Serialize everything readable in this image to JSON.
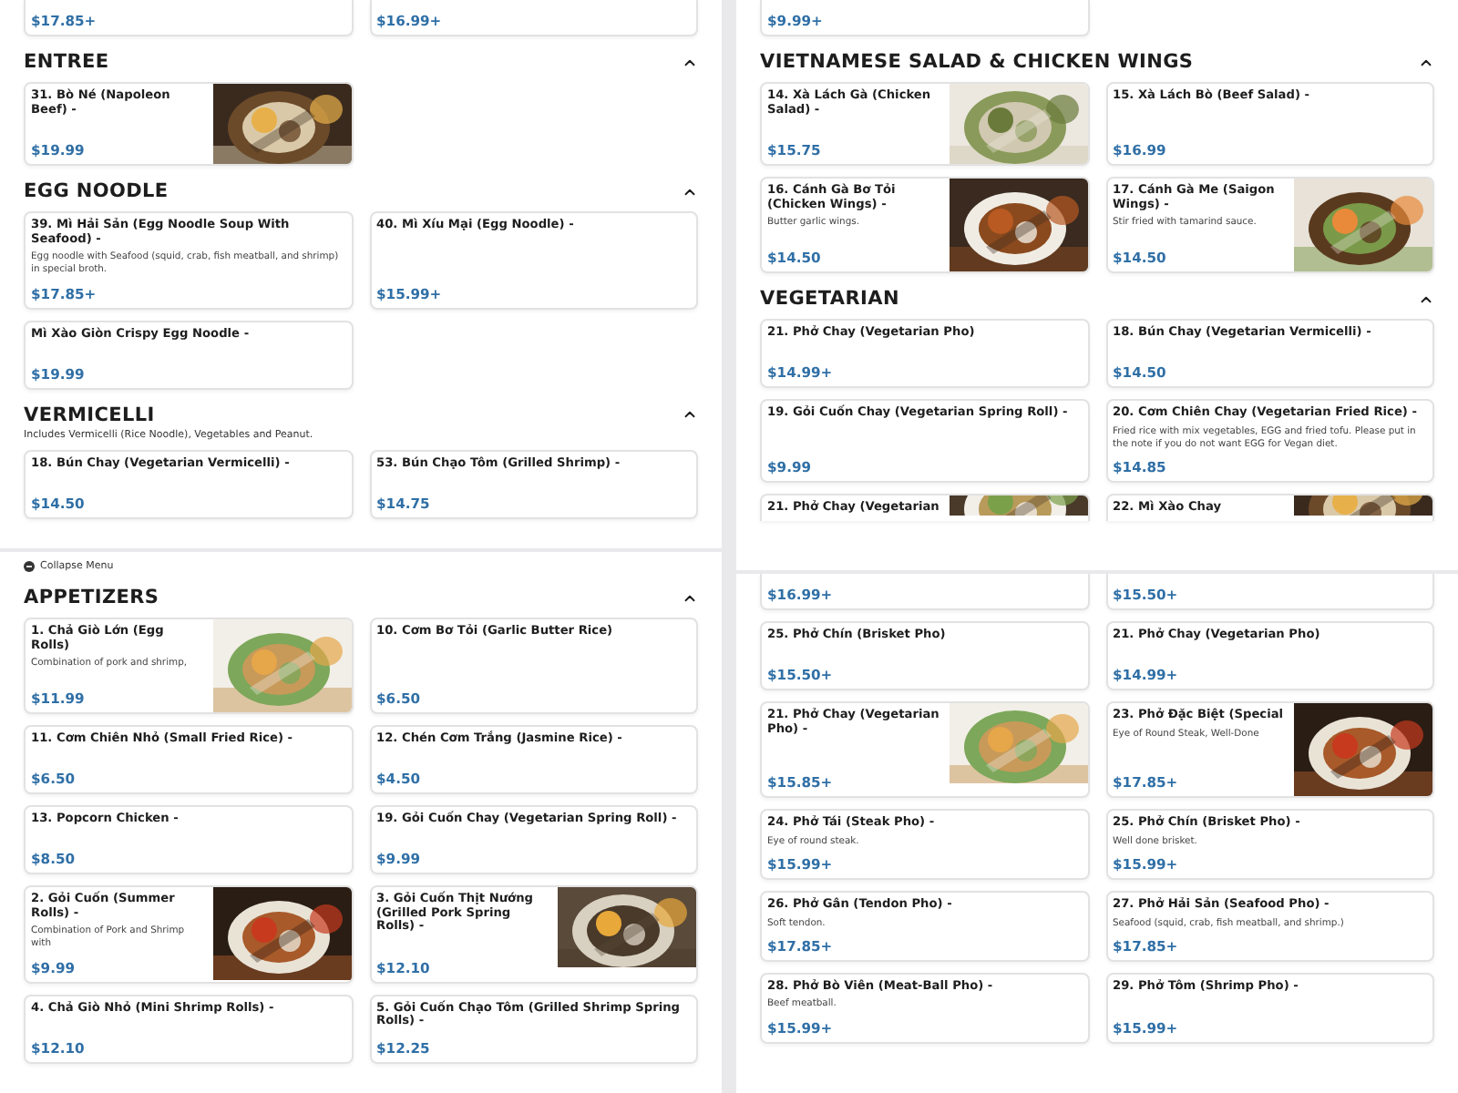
{
  "panes": [
    {
      "panels": [
        {
          "lead": [
            {
              "kind": "bottom",
              "price": "$17.85+"
            },
            {
              "kind": "bottom",
              "price": "$16.99+"
            }
          ],
          "sections": [
            {
              "title": "ENTREE",
              "expanded": true,
              "cards": [
                {
                  "kind": "full",
                  "title": "31. Bò Né (Napoleon Beef) -",
                  "price": "$19.99"
                }
              ]
            },
            {
              "title": "EGG NOODLE",
              "expanded": true,
              "cards": [
                {
                  "kind": "full",
                  "title": "39. Mì Hải Sản (Egg Noodle Soup With Seafood) -",
                  "description": "Egg noodle with Seafood (squid, crab, fish meatball, and shrimp) in special broth.",
                  "price": "$17.85+"
                },
                {
                  "kind": "full",
                  "title": "40. Mì Xíu Mại (Egg Noodle) -",
                  "price": "$15.99+"
                },
                {
                  "kind": "full",
                  "title": "Mì Xào Giòn Crispy Egg Noodle -",
                  "price": "$19.99"
                }
              ]
            },
            {
              "title": "VERMICELLI",
              "subtitle": "Includes Vermicelli (Rice Noodle), Vegetables and Peanut.",
              "expanded": true,
              "cards": [
                {
                  "kind": "full",
                  "title": "18. Bún Chay (Vegetarian Vermicelli) -",
                  "price": "$14.50"
                },
                {
                  "kind": "full",
                  "title": "53. Bún Chạo Tôm (Grilled Shrimp) -",
                  "price": "$14.75"
                }
              ]
            }
          ]
        },
        {
          "collapse": "Collapse Menu",
          "sections": [
            {
              "title": "APPETIZERS",
              "expanded": true,
              "cards": [
                {
                  "kind": "full",
                  "title": "1. Chả Giò Lớn (Egg Rolls)",
                  "description": "Combination of pork and shrimp,",
                  "price": "$11.99"
                },
                {
                  "kind": "full",
                  "title": "10. Cơm Bơ Tỏi (Garlic Butter Rice)",
                  "price": "$6.50"
                },
                {
                  "kind": "full",
                  "title": "11. Cơm Chiên Nhỏ (Small Fried Rice) -",
                  "price": "$6.50"
                },
                {
                  "kind": "full",
                  "title": "12. Chén Cơm Trắng (Jasmine Rice) -",
                  "price": "$4.50"
                },
                {
                  "kind": "full",
                  "title": "13. Popcorn Chicken -",
                  "price": "$8.50"
                },
                {
                  "kind": "full",
                  "title": "19. Gỏi Cuốn Chay (Vegetarian Spring Roll) -",
                  "price": "$9.99"
                },
                {
                  "kind": "full",
                  "title": "2. Gỏi Cuốn (Summer Rolls) -",
                  "description": "Combination of Pork and Shrimp with",
                  "price": "$9.99"
                },
                {
                  "kind": "full",
                  "title": "3. Gỏi Cuốn Thịt Nướng (Grilled Pork Spring Rolls) -",
                  "price": "$12.10"
                },
                {
                  "kind": "full",
                  "title": "4. Chả Giò Nhỏ (Mini Shrimp Rolls) -",
                  "price": "$12.10"
                },
                {
                  "kind": "full",
                  "title": "5. Gỏi Cuốn Chạo Tôm (Grilled Shrimp Spring Rolls) -",
                  "price": "$12.25"
                }
              ]
            }
          ]
        }
      ]
    },
    {
      "panels": [
        {
          "lead": [
            {
              "kind": "bottom",
              "price": "$9.99+"
            }
          ],
          "sections": [
            {
              "title": "VIETNAMESE SALAD & CHICKEN WINGS",
              "expanded": true,
              "cards": [
                {
                  "kind": "full",
                  "title": "14. Xà Lách Gà (Chicken Salad) -",
                  "price": "$15.75"
                },
                {
                  "kind": "full",
                  "title": "15. Xà Lách Bò (Beef Salad) -",
                  "price": "$16.99"
                },
                {
                  "kind": "full",
                  "title": "16. Cánh Gà Bơ Tỏi (Chicken Wings) -",
                  "description": "Butter garlic wings.",
                  "price": "$14.50"
                },
                {
                  "kind": "full",
                  "title": "17. Cánh Gà Me (Saigon Wings) -",
                  "description": "Stir fried with tamarind sauce.",
                  "price": "$14.50"
                }
              ]
            },
            {
              "title": "VEGETARIAN",
              "expanded": true,
              "cards": [
                {
                  "kind": "full",
                  "title": "21. Phở Chay (Vegetarian Pho)",
                  "price": "$14.99+"
                },
                {
                  "kind": "full",
                  "title": "18. Bún Chay (Vegetarian Vermicelli) -",
                  "price": "$14.50"
                },
                {
                  "kind": "full",
                  "title": "19. Gỏi Cuốn Chay (Vegetarian Spring Roll) -",
                  "price": "$9.99"
                },
                {
                  "kind": "full",
                  "title": "20. Cơm Chiên Chay (Vegetarian Fried Rice) -",
                  "description": "Fried rice with mix vegetables, EGG and fried tofu. Please put in the note if you do not want EGG for Vegan diet.",
                  "price": "$14.85"
                },
                {
                  "kind": "top",
                  "title": "21. Phở Chay (Vegetarian"
                },
                {
                  "kind": "top",
                  "title": "22. Mì Xào Chay"
                }
              ]
            }
          ]
        },
        {
          "lead": [
            {
              "kind": "bottom",
              "price": "$16.99+"
            },
            {
              "kind": "bottom",
              "price": "$15.50+"
            },
            {
              "kind": "full",
              "title": "25. Phở Chín (Brisket Pho)",
              "price": "$15.50+"
            },
            {
              "kind": "full",
              "title": "21. Phở Chay (Vegetarian Pho)",
              "price": "$14.99+"
            },
            {
              "kind": "full",
              "title": "21. Phở Chay (Vegetarian Pho) -",
              "price": "$15.85+"
            },
            {
              "kind": "full",
              "title": "23. Phở Đặc Biệt (Special",
              "description": "Eye of Round Steak, Well-Done",
              "price": "$17.85+"
            },
            {
              "kind": "full",
              "title": "24. Phở Tái (Steak Pho) -",
              "description": "Eye of round steak.",
              "price": "$15.99+"
            },
            {
              "kind": "full",
              "title": "25. Phở Chín (Brisket Pho) -",
              "description": "Well done brisket.",
              "price": "$15.99+"
            },
            {
              "kind": "full",
              "title": "26. Phở Gân (Tendon Pho) -",
              "description": "Soft tendon.",
              "price": "$17.85+"
            },
            {
              "kind": "full",
              "title": "27. Phở Hải Sản (Seafood Pho) -",
              "description": "Seafood (squid, crab, fish meatball, and shrimp.)",
              "price": "$17.85+"
            },
            {
              "kind": "full",
              "title": "28. Phở Bò Viên (Meat-Ball Pho) -",
              "description": "Beef meatball.",
              "price": "$15.99+"
            },
            {
              "kind": "full",
              "title": "29. Phở Tôm (Shrimp Pho) -",
              "price": "$15.99+"
            }
          ]
        }
      ]
    }
  ]
}
